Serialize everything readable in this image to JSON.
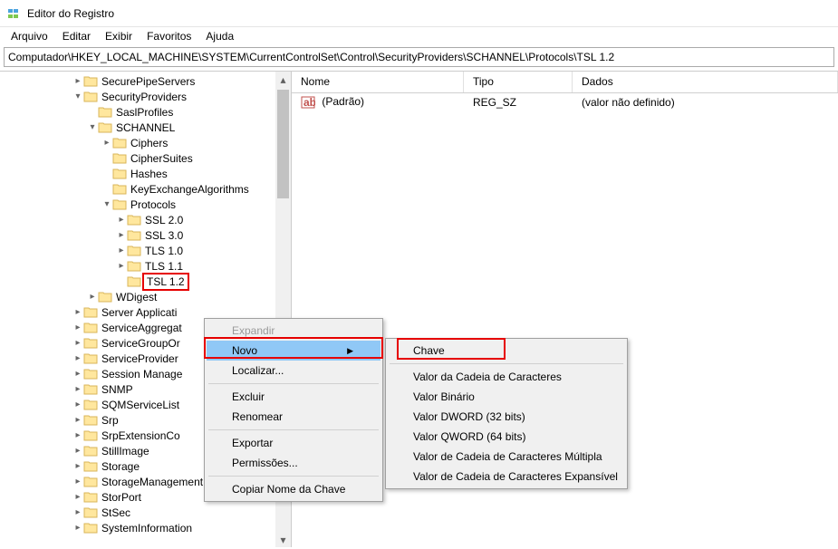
{
  "title": "Editor do Registro",
  "menu": [
    "Arquivo",
    "Editar",
    "Exibir",
    "Favoritos",
    "Ajuda"
  ],
  "address": "Computador\\HKEY_LOCAL_MACHINE\\SYSTEM\\CurrentControlSet\\Control\\SecurityProviders\\SCHANNEL\\Protocols\\TSL 1.2",
  "tree": {
    "items": [
      {
        "indent": 5,
        "exp": ">",
        "label": "SecurePipeServers"
      },
      {
        "indent": 5,
        "exp": "v",
        "label": "SecurityProviders"
      },
      {
        "indent": 6,
        "exp": "",
        "label": "SaslProfiles"
      },
      {
        "indent": 6,
        "exp": "v",
        "label": "SCHANNEL"
      },
      {
        "indent": 7,
        "exp": ">",
        "label": "Ciphers"
      },
      {
        "indent": 7,
        "exp": "",
        "label": "CipherSuites"
      },
      {
        "indent": 7,
        "exp": "",
        "label": "Hashes"
      },
      {
        "indent": 7,
        "exp": "",
        "label": "KeyExchangeAlgorithms"
      },
      {
        "indent": 7,
        "exp": "v",
        "label": "Protocols"
      },
      {
        "indent": 8,
        "exp": ">",
        "label": "SSL 2.0"
      },
      {
        "indent": 8,
        "exp": ">",
        "label": "SSL 3.0"
      },
      {
        "indent": 8,
        "exp": ">",
        "label": "TLS 1.0"
      },
      {
        "indent": 8,
        "exp": ">",
        "label": "TLS 1.1"
      },
      {
        "indent": 8,
        "exp": "",
        "label": "TSL 1.2",
        "highlight": true
      },
      {
        "indent": 6,
        "exp": ">",
        "label": "WDigest"
      },
      {
        "indent": 5,
        "exp": ">",
        "label": "Server Applicati",
        "truncated": true
      },
      {
        "indent": 5,
        "exp": ">",
        "label": "ServiceAggregat",
        "truncated": true
      },
      {
        "indent": 5,
        "exp": ">",
        "label": "ServiceGroupOr",
        "truncated": true
      },
      {
        "indent": 5,
        "exp": ">",
        "label": "ServiceProvider"
      },
      {
        "indent": 5,
        "exp": ">",
        "label": "Session Manage",
        "truncated": true
      },
      {
        "indent": 5,
        "exp": ">",
        "label": "SNMP"
      },
      {
        "indent": 5,
        "exp": ">",
        "label": "SQMServiceList"
      },
      {
        "indent": 5,
        "exp": ">",
        "label": "Srp"
      },
      {
        "indent": 5,
        "exp": ">",
        "label": "SrpExtensionCo",
        "truncated": true
      },
      {
        "indent": 5,
        "exp": ">",
        "label": "StillImage"
      },
      {
        "indent": 5,
        "exp": ">",
        "label": "Storage"
      },
      {
        "indent": 5,
        "exp": ">",
        "label": "StorageManagement"
      },
      {
        "indent": 5,
        "exp": ">",
        "label": "StorPort"
      },
      {
        "indent": 5,
        "exp": ">",
        "label": "StSec"
      },
      {
        "indent": 5,
        "exp": ">",
        "label": "SystemInformation"
      }
    ]
  },
  "list": {
    "columns": [
      "Nome",
      "Tipo",
      "Dados"
    ],
    "rows": [
      {
        "name": "(Padrão)",
        "type": "REG_SZ",
        "data": "(valor não definido)"
      }
    ]
  },
  "ctx1": {
    "expand": "Expandir",
    "novo": "Novo",
    "localizar": "Localizar...",
    "excluir": "Excluir",
    "renomear": "Renomear",
    "exportar": "Exportar",
    "permissoes": "Permissões...",
    "copiar": "Copiar Nome da Chave"
  },
  "ctx2": {
    "chave": "Chave",
    "string": "Valor da Cadeia de Caracteres",
    "binario": "Valor Binário",
    "dword": "Valor DWORD (32 bits)",
    "qword": "Valor QWORD (64 bits)",
    "multi": "Valor de Cadeia de Caracteres Múltipla",
    "expand": "Valor de Cadeia de Caracteres Expansível"
  }
}
